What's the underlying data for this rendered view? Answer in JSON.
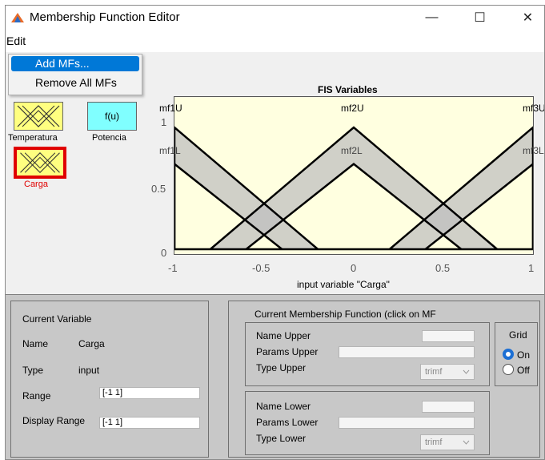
{
  "window": {
    "title": "Membership Function Editor",
    "minimize_glyph": "—",
    "maximize_glyph": "☐",
    "close_glyph": "✕"
  },
  "menu": {
    "edit": "Edit",
    "dropdown": [
      "Add MFs...",
      "Remove All MFs"
    ]
  },
  "fis_panel": {
    "inputs": [
      {
        "name": "Temperatura",
        "icon": "mf-triangles-icon",
        "color": "#ffff80"
      },
      {
        "name": "Carga",
        "icon": "mf-triangles-icon",
        "color": "#ffff80",
        "selected": true
      }
    ],
    "outputs": [
      {
        "name": "Potencia",
        "label": "f(u)",
        "color": "#80ffff"
      }
    ]
  },
  "plot": {
    "title": "FIS Variables",
    "xlabel": "input variable \"Carga\"",
    "x_ticks": [
      "-1",
      "-0.5",
      "0",
      "0.5",
      "1"
    ],
    "y_ticks": [
      "0",
      "0.5",
      "1"
    ],
    "mf_labels_upper": [
      "mf1U",
      "mf2U",
      "mf3U"
    ],
    "mf_labels_lower": [
      "mf1L",
      "mf2L",
      "mf3L"
    ]
  },
  "chart_data": {
    "type": "line",
    "xlim": [
      -1,
      1
    ],
    "ylim": [
      0,
      1
    ],
    "xlabel": "input variable \"Carga\"",
    "title": "FIS Variables",
    "series": [
      {
        "name": "mf1U",
        "x": [
          -1,
          -1,
          -0.2
        ],
        "y": [
          0,
          1,
          0
        ]
      },
      {
        "name": "mf1L",
        "x": [
          -1,
          -1,
          -0.4
        ],
        "y": [
          0,
          0.7,
          0
        ]
      },
      {
        "name": "mf2U",
        "x": [
          -0.8,
          0,
          0.8
        ],
        "y": [
          0,
          1,
          0
        ]
      },
      {
        "name": "mf2L",
        "x": [
          -0.6,
          0,
          0.6
        ],
        "y": [
          0,
          0.7,
          0
        ]
      },
      {
        "name": "mf3U",
        "x": [
          0.2,
          1,
          1
        ],
        "y": [
          0,
          1,
          0
        ]
      },
      {
        "name": "mf3L",
        "x": [
          0.4,
          1,
          1
        ],
        "y": [
          0,
          0.7,
          0
        ]
      }
    ],
    "band_color": "#c0c0c0"
  },
  "current_variable": {
    "heading": "Current Variable",
    "name_label": "Name",
    "name_value": "Carga",
    "type_label": "Type",
    "type_value": "input",
    "range_label": "Range",
    "range_value": "[-1 1]",
    "display_range_label": "Display Range",
    "display_range_value": "[-1 1]"
  },
  "current_mf": {
    "heading": "Current Membership Function (click on MF",
    "name_upper_label": "Name Upper",
    "params_upper_label": "Params Upper",
    "type_upper_label": "Type Upper",
    "type_upper_value": "trimf",
    "name_lower_label": "Name Lower",
    "params_lower_label": "Params Lower",
    "type_lower_label": "Type Lower",
    "type_lower_value": "trimf"
  },
  "grid": {
    "heading": "Grid",
    "on_label": "On",
    "off_label": "Off",
    "selected": "On"
  }
}
